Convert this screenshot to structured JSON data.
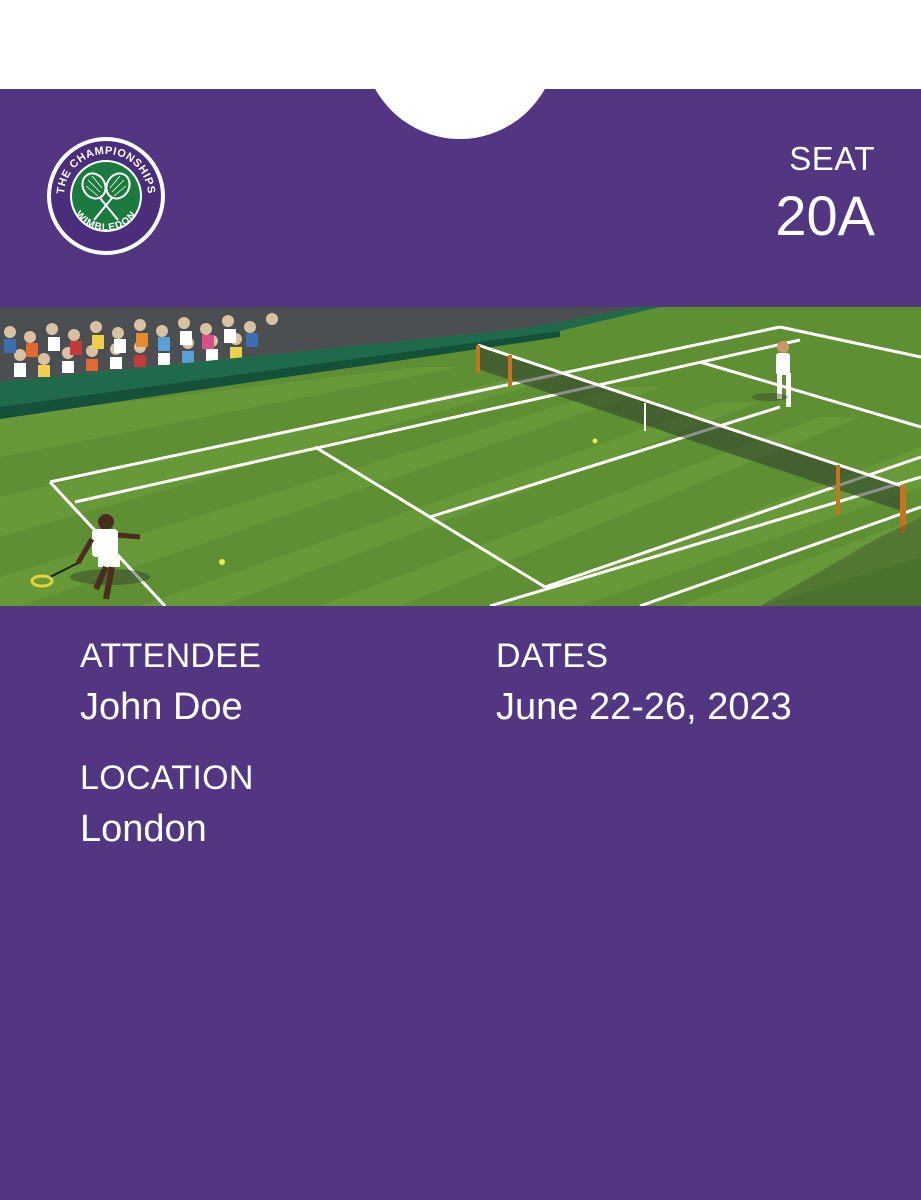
{
  "brand": {
    "logo_top_text": "THE CHAMPIONSHIPS",
    "logo_bottom_text": "WIMBLEDON",
    "colors": {
      "pass_background": "#523682",
      "logo_green": "#1b7a3d",
      "court_green": "#5f8f33"
    }
  },
  "seat": {
    "label": "SEAT",
    "value": "20A"
  },
  "hero_image": {
    "icon": "tennis-court-photo"
  },
  "fields": {
    "attendee": {
      "label": "ATTENDEE",
      "value": "John Doe"
    },
    "dates": {
      "label": "DATES",
      "value": "June 22-26, 2023"
    },
    "location": {
      "label": "LOCATION",
      "value": "London"
    }
  }
}
